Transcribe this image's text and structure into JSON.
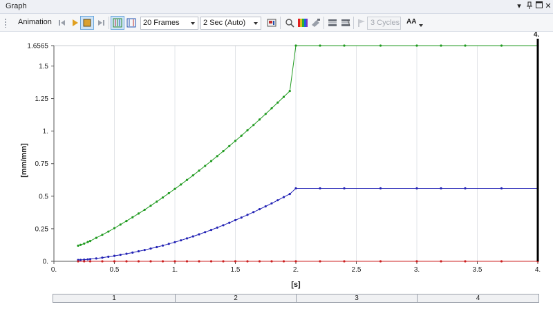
{
  "window": {
    "title": "Graph"
  },
  "toolbar": {
    "animation_label": "Animation",
    "frames_value": "20 Frames",
    "duration_value": "2 Sec (Auto)",
    "cycles_value": "3 Cycles",
    "text_size_label": "AA"
  },
  "chart_data": {
    "type": "line",
    "xlabel": "[s]",
    "ylabel": "[mm/mm]",
    "xlim": [
      0,
      4
    ],
    "ylim": [
      0,
      1.6565
    ],
    "x_ticks": [
      "0.",
      "0.5",
      "1.",
      "1.5",
      "2.",
      "2.5",
      "3.",
      "3.5",
      "4."
    ],
    "y_ticks": [
      "0.",
      "0.25",
      "0.5",
      "0.75",
      "1.",
      "1.25",
      "1.5",
      "1.6565"
    ],
    "x_tick_values": [
      0,
      0.5,
      1,
      1.5,
      2,
      2.5,
      3,
      3.5,
      4
    ],
    "y_tick_values": [
      0,
      0.25,
      0.5,
      0.75,
      1,
      1.25,
      1.5,
      1.6565
    ],
    "cursor": {
      "x": 4,
      "label": "4."
    },
    "grid": true,
    "series": [
      {
        "color": "#1f9a1f",
        "points": [
          [
            0.2,
            0.12
          ],
          [
            0.22,
            0.126
          ],
          [
            0.25,
            0.136
          ],
          [
            0.28,
            0.148
          ],
          [
            0.3,
            0.156
          ],
          [
            0.35,
            0.18
          ],
          [
            0.4,
            0.204
          ],
          [
            0.45,
            0.228
          ],
          [
            0.5,
            0.255
          ],
          [
            0.55,
            0.282
          ],
          [
            0.6,
            0.31
          ],
          [
            0.65,
            0.338
          ],
          [
            0.7,
            0.367
          ],
          [
            0.75,
            0.396
          ],
          [
            0.8,
            0.427
          ],
          [
            0.85,
            0.458
          ],
          [
            0.9,
            0.49
          ],
          [
            0.95,
            0.523
          ],
          [
            1.0,
            0.556
          ],
          [
            1.05,
            0.59
          ],
          [
            1.1,
            0.625
          ],
          [
            1.15,
            0.66
          ],
          [
            1.2,
            0.696
          ],
          [
            1.25,
            0.733
          ],
          [
            1.3,
            0.77
          ],
          [
            1.35,
            0.808
          ],
          [
            1.4,
            0.846
          ],
          [
            1.45,
            0.885
          ],
          [
            1.5,
            0.925
          ],
          [
            1.55,
            0.965
          ],
          [
            1.6,
            1.006
          ],
          [
            1.65,
            1.047
          ],
          [
            1.7,
            1.089
          ],
          [
            1.75,
            1.132
          ],
          [
            1.8,
            1.175
          ],
          [
            1.85,
            1.219
          ],
          [
            1.9,
            1.263
          ],
          [
            1.95,
            1.308
          ],
          [
            2.0,
            1.6565
          ],
          [
            2.2,
            1.6565
          ],
          [
            2.4,
            1.6565
          ],
          [
            2.7,
            1.6565
          ],
          [
            3.0,
            1.6565
          ],
          [
            3.2,
            1.6565
          ],
          [
            3.4,
            1.6565
          ],
          [
            3.7,
            1.6565
          ],
          [
            4.0,
            1.6565
          ]
        ]
      },
      {
        "color": "#2323b5",
        "points": [
          [
            0.2,
            0.01
          ],
          [
            0.22,
            0.011
          ],
          [
            0.25,
            0.013
          ],
          [
            0.28,
            0.015
          ],
          [
            0.3,
            0.017
          ],
          [
            0.35,
            0.022
          ],
          [
            0.4,
            0.028
          ],
          [
            0.45,
            0.035
          ],
          [
            0.5,
            0.042
          ],
          [
            0.55,
            0.05
          ],
          [
            0.6,
            0.058
          ],
          [
            0.65,
            0.067
          ],
          [
            0.7,
            0.077
          ],
          [
            0.75,
            0.087
          ],
          [
            0.8,
            0.098
          ],
          [
            0.85,
            0.109
          ],
          [
            0.9,
            0.121
          ],
          [
            0.95,
            0.134
          ],
          [
            1.0,
            0.147
          ],
          [
            1.05,
            0.161
          ],
          [
            1.1,
            0.176
          ],
          [
            1.15,
            0.191
          ],
          [
            1.2,
            0.207
          ],
          [
            1.25,
            0.224
          ],
          [
            1.3,
            0.241
          ],
          [
            1.35,
            0.259
          ],
          [
            1.4,
            0.277
          ],
          [
            1.45,
            0.296
          ],
          [
            1.5,
            0.316
          ],
          [
            1.55,
            0.336
          ],
          [
            1.6,
            0.357
          ],
          [
            1.65,
            0.378
          ],
          [
            1.7,
            0.4
          ],
          [
            1.75,
            0.422
          ],
          [
            1.8,
            0.445
          ],
          [
            1.85,
            0.469
          ],
          [
            1.9,
            0.493
          ],
          [
            1.95,
            0.517
          ],
          [
            2.0,
            0.56
          ],
          [
            2.2,
            0.56
          ],
          [
            2.4,
            0.56
          ],
          [
            2.7,
            0.56
          ],
          [
            3.0,
            0.56
          ],
          [
            3.2,
            0.56
          ],
          [
            3.4,
            0.56
          ],
          [
            3.7,
            0.56
          ],
          [
            4.0,
            0.56
          ]
        ]
      },
      {
        "color": "#cc2020",
        "points": [
          [
            0.2,
            0.0
          ],
          [
            0.25,
            0.0
          ],
          [
            0.3,
            0.0
          ],
          [
            0.4,
            0.0
          ],
          [
            0.5,
            0.0
          ],
          [
            0.6,
            0.0
          ],
          [
            0.7,
            0.0
          ],
          [
            0.8,
            0.0
          ],
          [
            0.9,
            0.0
          ],
          [
            1.0,
            0.0
          ],
          [
            1.1,
            0.0
          ],
          [
            1.2,
            0.0
          ],
          [
            1.3,
            0.0
          ],
          [
            1.4,
            0.0
          ],
          [
            1.5,
            0.0
          ],
          [
            1.6,
            0.0
          ],
          [
            1.7,
            0.0
          ],
          [
            1.8,
            0.0
          ],
          [
            1.9,
            0.0
          ],
          [
            2.0,
            0.0
          ],
          [
            2.2,
            0.0
          ],
          [
            2.4,
            0.0
          ],
          [
            2.7,
            0.0
          ],
          [
            3.0,
            0.0
          ],
          [
            3.2,
            0.0
          ],
          [
            3.4,
            0.0
          ],
          [
            3.7,
            0.0
          ],
          [
            4.0,
            0.0
          ]
        ]
      }
    ]
  },
  "timeline": {
    "segments": [
      "1",
      "2",
      "3",
      "4"
    ]
  }
}
